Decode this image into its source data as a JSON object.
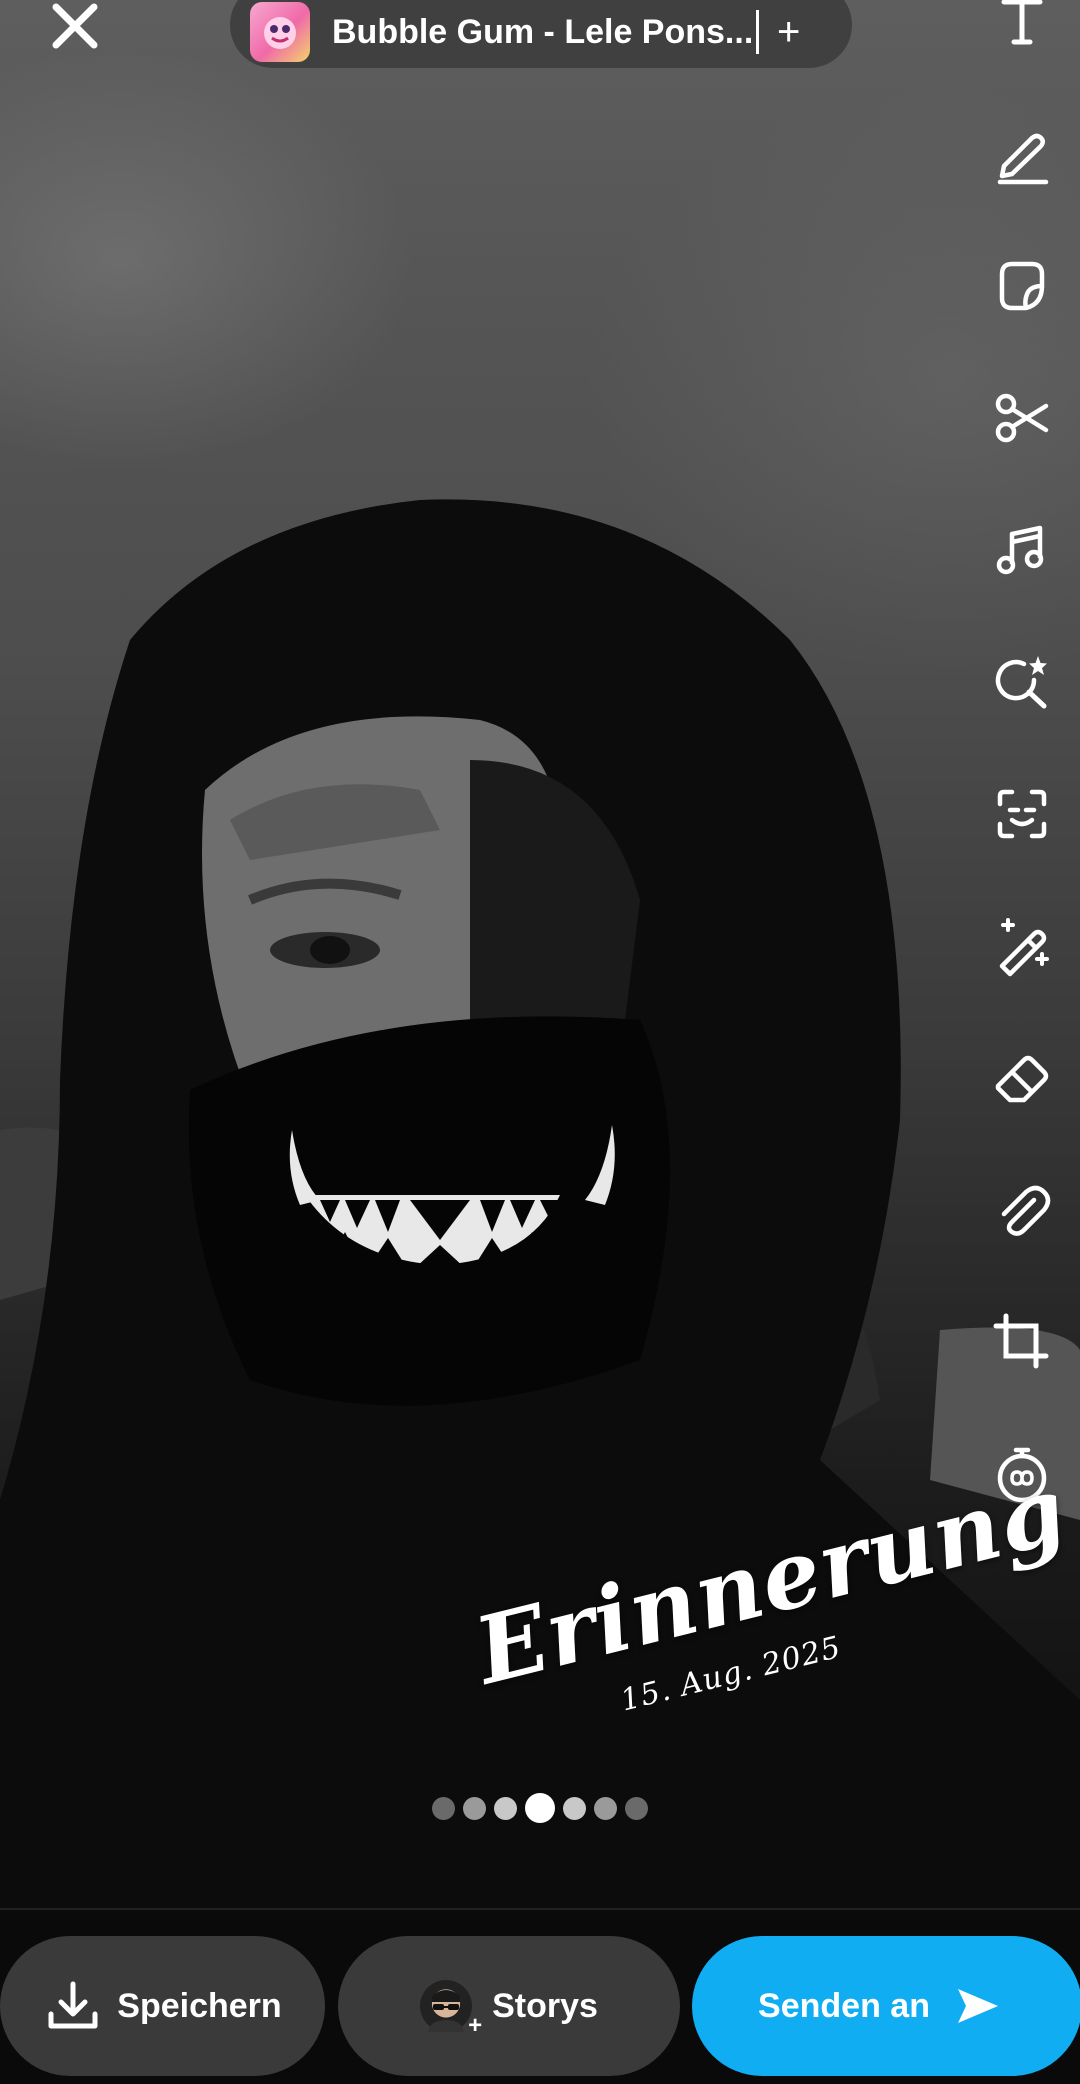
{
  "music": {
    "title": "Bubble Gum - Lele Pons...",
    "add_label": "+"
  },
  "toolbar": {
    "tools": [
      "text-tool",
      "pen-tool",
      "sticker-tool",
      "scissors-tool",
      "music-tool",
      "lens-tool",
      "ai-scan-tool",
      "magic-wand-tool",
      "eraser-tool",
      "attachment-tool",
      "crop-tool",
      "timer-tool"
    ]
  },
  "memory": {
    "title": "Erinnerung",
    "date": "15. Aug. 2025"
  },
  "pager": {
    "count": 7,
    "active_index": 3
  },
  "actions": {
    "save_label": "Speichern",
    "stories_label": "Storys",
    "send_label": "Senden an"
  },
  "colors": {
    "send_button": "#10adf2",
    "pill_background": "#3a3a3a"
  }
}
